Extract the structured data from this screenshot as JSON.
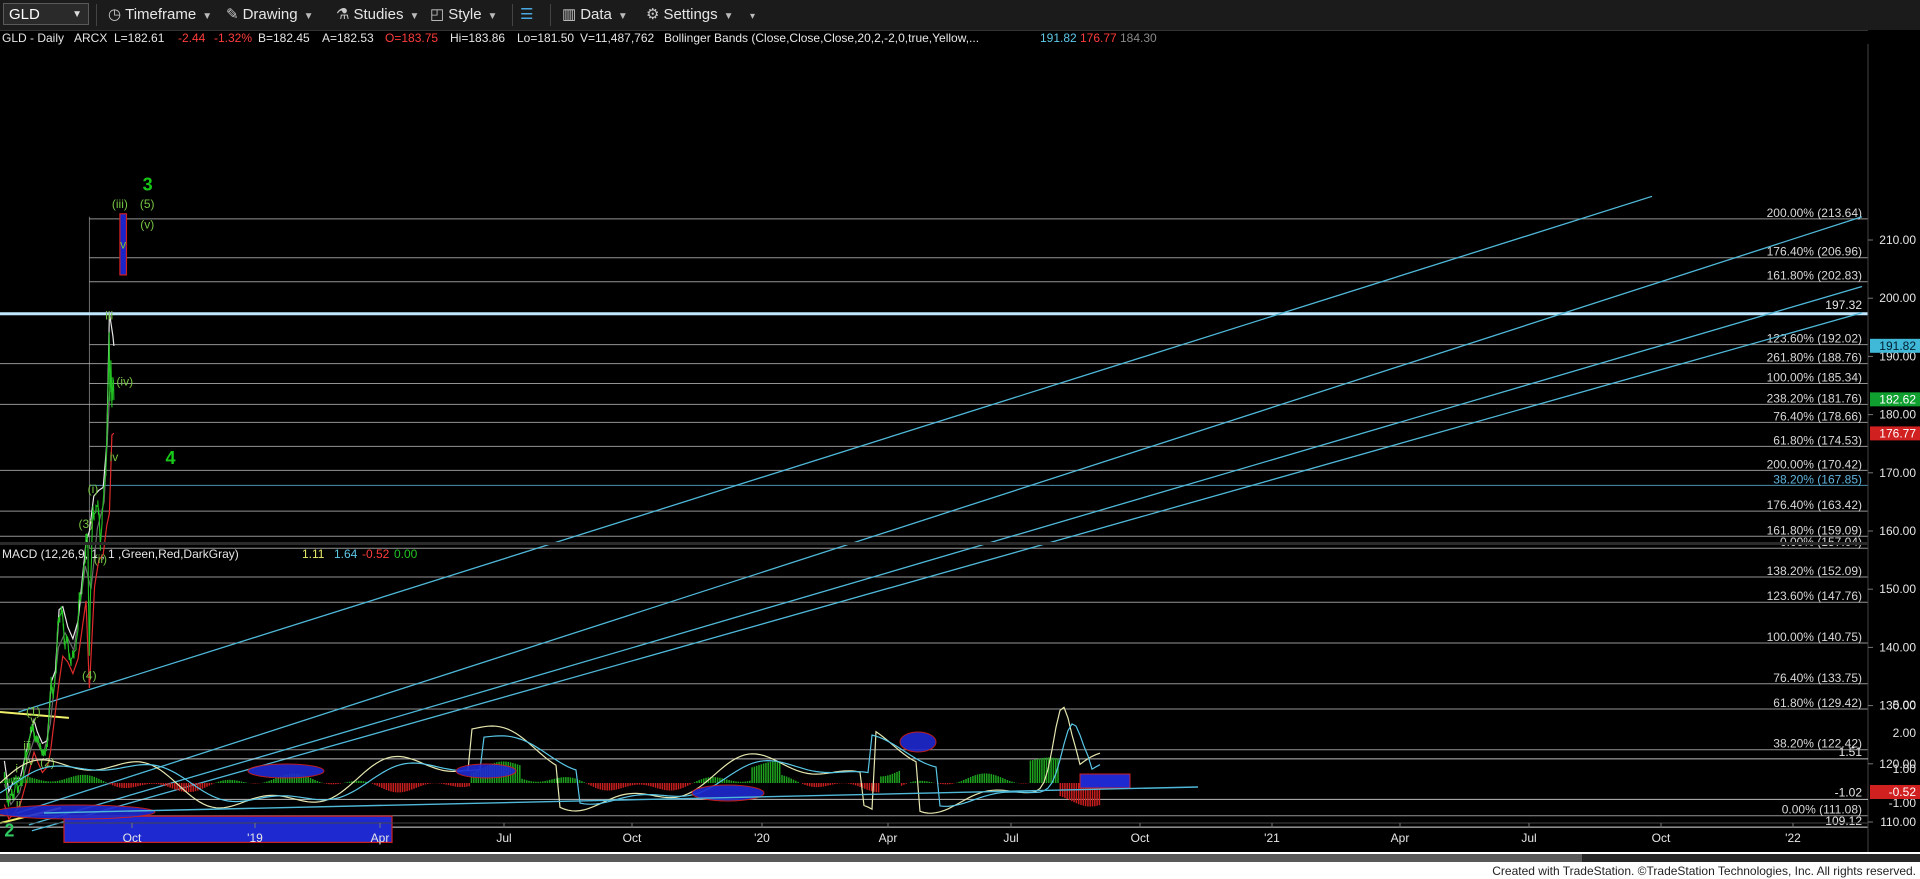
{
  "toolbar": {
    "symbol": "GLD",
    "timeframe": "Timeframe",
    "drawing": "Drawing",
    "studies": "Studies",
    "style": "Style",
    "data": "Data",
    "settings": "Settings"
  },
  "header": {
    "symbol": "GLD - Daily",
    "exchange": "ARCX",
    "last": "L=182.61",
    "change": "-2.44",
    "change_pct": "-1.32%",
    "bid": "B=182.45",
    "ask": "A=182.53",
    "open": "O=183.75",
    "high": "Hi=183.86",
    "low": "Lo=181.50",
    "volume": "V=11,487,762",
    "bb_label": "Bollinger Bands (Close,Close,Close,20,2,-2,0,true,Yellow,...",
    "bb_upper": "191.82",
    "bb_lower": "176.77",
    "bb_mid": "184.30"
  },
  "macd_header": {
    "label": "MACD (12,26,9, 1 , 1 ,Green,Red,DarkGray)",
    "v1": "1.11",
    "v2": "1.64",
    "v3": "-0.52",
    "v4": "0.00"
  },
  "footer": {
    "copyright": "Created with TradeStation. ©TradeStation Technologies, Inc. All rights reserved."
  },
  "colors": {
    "price": "#22c322",
    "bb_upper": "#e6e6e6",
    "bb_lower": "#e02b2b",
    "bb_mid": "#6a6a6a",
    "channel": "#4fb8d8",
    "fib": "#b9b9b9",
    "trend_yellow": "#f0f06a",
    "label_green": "#76c442",
    "macd_line": "#e6e6b0",
    "signal_line": "#58c6e6"
  },
  "chart_data": {
    "type": "line",
    "x_ticks": [
      "Oct",
      "'19",
      "Apr",
      "Jul",
      "Oct",
      "'20",
      "Apr",
      "Jul",
      "Oct",
      "'21",
      "Apr",
      "Jul",
      "Oct",
      "'22"
    ],
    "y_ticks": [
      110,
      120,
      130,
      140,
      150,
      160,
      170,
      180,
      190,
      200,
      210
    ],
    "ylim": [
      106,
      220
    ],
    "price_series": [
      [
        "2018-08-01",
        117.5
      ],
      [
        "2018-08-20",
        113.5
      ],
      [
        "2018-09-10",
        113.5
      ],
      [
        "2018-10-01",
        114
      ],
      [
        "2018-10-15",
        115.5
      ],
      [
        "2018-10-26",
        116.8
      ],
      [
        "2018-11-08",
        114.5
      ],
      [
        "2018-12-03",
        116.8
      ],
      [
        "2018-12-24",
        120.5
      ],
      [
        "2019-01-04",
        121
      ],
      [
        "2019-01-31",
        124.5
      ],
      [
        "2019-02-20",
        126.3
      ],
      [
        "2019-03-05",
        122.8
      ],
      [
        "2019-03-25",
        124.5
      ],
      [
        "2019-04-23",
        120.5
      ],
      [
        "2019-05-15",
        122.3
      ],
      [
        "2019-05-30",
        122
      ],
      [
        "2019-06-06",
        126.5
      ],
      [
        "2019-06-25",
        133
      ],
      [
        "2019-07-10",
        132
      ],
      [
        "2019-07-31",
        135
      ],
      [
        "2019-08-07",
        142
      ],
      [
        "2019-08-15",
        143.5
      ],
      [
        "2019-09-04",
        146.5
      ],
      [
        "2019-09-20",
        142.5
      ],
      [
        "2019-10-01",
        140
      ],
      [
        "2019-10-18",
        140.5
      ],
      [
        "2019-11-12",
        137
      ],
      [
        "2019-12-03",
        138
      ],
      [
        "2019-12-31",
        143
      ],
      [
        "2020-01-08",
        148.5
      ],
      [
        "2020-01-28",
        149
      ],
      [
        "2020-02-20",
        155
      ],
      [
        "2020-02-24",
        158
      ],
      [
        "2020-03-09",
        157.5
      ],
      [
        "2020-03-19",
        138
      ],
      [
        "2020-03-30",
        152
      ],
      [
        "2020-04-09",
        160
      ],
      [
        "2020-04-14",
        164
      ],
      [
        "2020-04-22",
        161
      ],
      [
        "2020-05-18",
        165
      ],
      [
        "2020-05-28",
        161
      ],
      [
        "2020-06-05",
        157.5
      ],
      [
        "2020-06-29",
        165.5
      ],
      [
        "2020-07-14",
        170.5
      ],
      [
        "2020-07-28",
        182
      ],
      [
        "2020-08-06",
        193.9
      ],
      [
        "2020-08-11",
        181.5
      ],
      [
        "2020-08-18",
        189
      ],
      [
        "2020-08-25",
        180.5
      ],
      [
        "2020-09-01",
        186
      ],
      [
        "2020-09-08",
        182.5
      ]
    ],
    "bb_upper": [
      [
        "2018-08-01",
        120.5
      ],
      [
        "2018-09-01",
        115.2
      ],
      [
        "2018-10-12",
        117.5
      ],
      [
        "2018-11-20",
        117.5
      ],
      [
        "2019-01-10",
        123
      ],
      [
        "2019-02-25",
        127.5
      ],
      [
        "2019-03-20",
        125.5
      ],
      [
        "2019-04-25",
        123.5
      ],
      [
        "2019-05-30",
        124
      ],
      [
        "2019-06-25",
        134
      ],
      [
        "2019-07-25",
        136
      ],
      [
        "2019-08-20",
        146.5
      ],
      [
        "2019-09-15",
        147
      ],
      [
        "2019-10-20",
        143.5
      ],
      [
        "2019-11-25",
        141.5
      ],
      [
        "2019-12-31",
        144.5
      ],
      [
        "2020-02-25",
        158
      ],
      [
        "2020-03-20",
        160
      ],
      [
        "2020-04-20",
        166
      ],
      [
        "2020-05-25",
        167
      ],
      [
        "2020-06-25",
        167.5
      ],
      [
        "2020-07-20",
        175
      ],
      [
        "2020-08-07",
        197.5
      ],
      [
        "2020-09-01",
        193.5
      ],
      [
        "2020-09-08",
        191.8
      ]
    ],
    "bb_lower": [
      [
        "2018-08-01",
        113
      ],
      [
        "2018-09-01",
        110.5
      ],
      [
        "2018-10-10",
        111.5
      ],
      [
        "2018-11-20",
        113
      ],
      [
        "2019-01-15",
        118
      ],
      [
        "2019-02-25",
        122
      ],
      [
        "2019-03-20",
        120.5
      ],
      [
        "2019-04-25",
        118.5
      ],
      [
        "2019-05-30",
        119.5
      ],
      [
        "2019-06-20",
        122
      ],
      [
        "2019-07-25",
        129
      ],
      [
        "2019-08-20",
        134
      ],
      [
        "2019-09-15",
        138.5
      ],
      [
        "2019-10-20",
        137.5
      ],
      [
        "2019-11-25",
        135.5
      ],
      [
        "2019-12-31",
        138
      ],
      [
        "2020-02-25",
        148
      ],
      [
        "2020-03-20",
        133
      ],
      [
        "2020-04-25",
        150.5
      ],
      [
        "2020-05-25",
        155
      ],
      [
        "2020-06-25",
        156
      ],
      [
        "2020-07-20",
        161
      ],
      [
        "2020-08-07",
        163
      ],
      [
        "2020-08-25",
        176.5
      ],
      [
        "2020-09-08",
        176.8
      ]
    ],
    "bb_mid": [
      [
        "2018-08-01",
        116.5
      ],
      [
        "2018-09-15",
        113
      ],
      [
        "2018-11-15",
        115
      ],
      [
        "2019-01-15",
        121
      ],
      [
        "2019-03-01",
        124.5
      ],
      [
        "2019-05-01",
        121.5
      ],
      [
        "2019-06-20",
        127
      ],
      [
        "2019-08-15",
        140
      ],
      [
        "2019-10-01",
        142.5
      ],
      [
        "2019-12-01",
        139.5
      ],
      [
        "2020-02-20",
        154
      ],
      [
        "2020-03-31",
        150
      ],
      [
        "2020-05-15",
        160.5
      ],
      [
        "2020-07-01",
        165
      ],
      [
        "2020-08-10",
        184
      ],
      [
        "2020-09-08",
        184.3
      ]
    ],
    "fib_levels": [
      {
        "label": "200.00% (213.64)",
        "value": 213.64,
        "x0": "2020-03-20"
      },
      {
        "label": "176.40% (206.96)",
        "value": 206.96,
        "x0": "2020-03-20"
      },
      {
        "label": "161.80% (202.83)",
        "value": 202.83,
        "x0": "2020-03-20"
      },
      {
        "label": "123.60% (192.02)",
        "value": 192.02,
        "x0": "2020-03-20"
      },
      {
        "label": "261.80% (188.76)",
        "value": 188.76,
        "x0": "2018-07-01"
      },
      {
        "label": "100.00% (185.34)",
        "value": 185.34,
        "x0": "2020-03-20"
      },
      {
        "label": "238.20% (181.76)",
        "value": 181.76,
        "x0": "2018-07-01"
      },
      {
        "label": "76.40% (178.66)",
        "value": 178.66,
        "x0": "2020-03-20"
      },
      {
        "label": "61.80% (174.53)",
        "value": 174.53,
        "x0": "2020-03-20"
      },
      {
        "label": "200.00% (170.42)",
        "value": 170.42,
        "x0": "2018-07-01"
      },
      {
        "label": "38.20% (167.85)",
        "value": 167.85,
        "x0": "2020-03-20",
        "color": "#5fb4dc"
      },
      {
        "label": "176.40% (163.42)",
        "value": 163.42,
        "x0": "2018-07-01"
      },
      {
        "label": "161.80% (159.09)",
        "value": 159.09,
        "x0": "2018-07-01"
      },
      {
        "label": "0.00% (157.04)",
        "value": 157.04,
        "x0": "2020-03-20"
      },
      {
        "label": "138.20% (152.09)",
        "value": 152.09,
        "x0": "2018-07-01"
      },
      {
        "label": "123.60% (147.76)",
        "value": 147.76,
        "x0": "2018-07-01"
      },
      {
        "label": "100.00% (140.75)",
        "value": 140.75,
        "x0": "2018-07-01"
      },
      {
        "label": "76.40% (133.75)",
        "value": 133.75,
        "x0": "2018-07-01"
      },
      {
        "label": "61.80% (129.42)",
        "value": 129.42,
        "x0": "2018-07-01"
      },
      {
        "label": "38.20% (122.42)",
        "value": 122.42,
        "x0": "2018-07-01"
      },
      {
        "label": "0.00% (111.08)",
        "value": 111.08,
        "x0": "2018-07-01"
      }
    ],
    "level_197": "197.32",
    "level_109": "109.12",
    "price_badges": [
      {
        "label": "191.82",
        "value": 191.82,
        "bg": "#40b8d8",
        "fg": "#002030"
      },
      {
        "label": "182.62",
        "value": 182.62,
        "bg": "#10a030",
        "fg": "#ffffff"
      },
      {
        "label": "176.77",
        "value": 176.77,
        "bg": "#d02020",
        "fg": "#ffffff"
      }
    ],
    "wave_labels": [
      {
        "text": "(1)",
        "x": "2019-02-20",
        "y": 128.3
      },
      {
        "text": "v",
        "x": "2019-02-20",
        "y": 126.8
      },
      {
        "text": "iii",
        "x": "2019-01-08",
        "y": 122.5
      },
      {
        "text": "iv",
        "x": "2019-01-26",
        "y": 119.8
      },
      {
        "text": "i",
        "x": "2018-10-26",
        "y": 118.5
      },
      {
        "text": "ii",
        "x": "2018-11-08",
        "y": 112.5
      },
      {
        "text": "(2)",
        "x": "2019-05-30",
        "y": 119.5
      },
      {
        "text": "(3)",
        "x": "2020-02-24",
        "y": 160.5
      },
      {
        "text": "(4)",
        "x": "2020-03-19",
        "y": 134.5
      },
      {
        "text": "(i)",
        "x": "2020-04-14",
        "y": 166.5
      },
      {
        "text": "(ii)",
        "x": "2020-06-05",
        "y": 154.5
      },
      {
        "text": "iii",
        "x": "2020-08-06",
        "y": 196.3
      },
      {
        "text": "iv",
        "x": "2020-09-08",
        "y": 172
      },
      {
        "text": "(iv)",
        "x": "2020-11-23",
        "y": 185
      },
      {
        "text": "(iii)",
        "x": "2020-10-20",
        "y": 215.5
      },
      {
        "text": "(5)",
        "x": "2021-04-30",
        "y": 215.5
      },
      {
        "text": "(v)",
        "x": "2021-04-30",
        "y": 212
      }
    ],
    "big_labels": [
      {
        "text": "2",
        "x": "2018-09-05",
        "y": 107.5,
        "color": "#30c860"
      },
      {
        "text": "4",
        "x": "2021-10-10",
        "y": 171.5,
        "color": "#18c818"
      },
      {
        "text": "3",
        "x": "2021-05-03",
        "y": 218.5,
        "color": "#18c818"
      }
    ],
    "target_box": {
      "label": "v",
      "x0": "2020-10-20",
      "x1": "2020-12-05",
      "y0": 204,
      "y1": 214.5
    }
  },
  "macd_data": {
    "y_ticks": [
      "5.00",
      "2.00",
      "1.00",
      "-1.00"
    ],
    "level_upper": "1.51",
    "level_lower": "-1.02",
    "badge_value": "-0.52"
  }
}
